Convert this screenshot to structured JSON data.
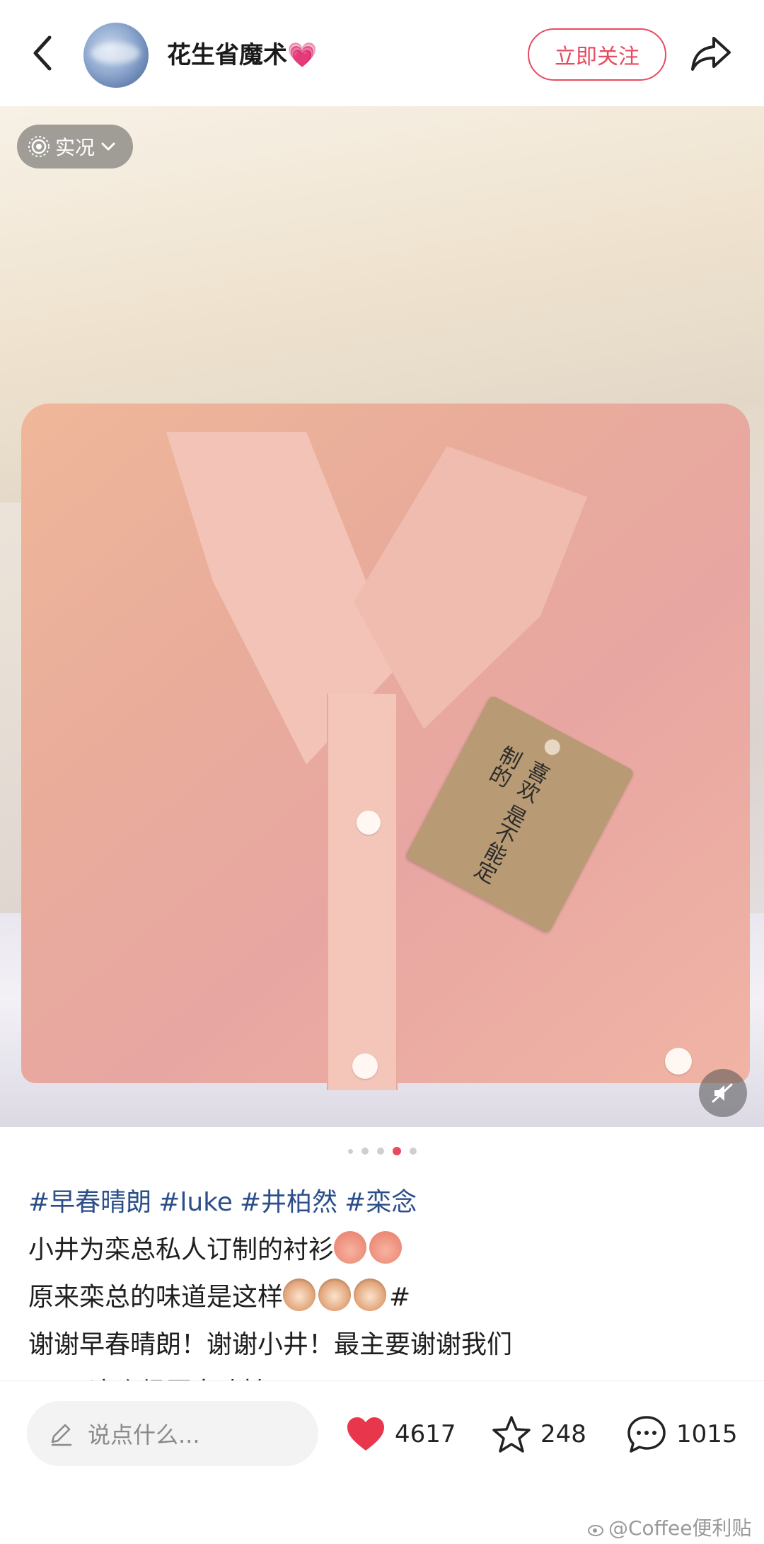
{
  "header": {
    "username": "花生省魔术💗",
    "follow_label": "立即关注"
  },
  "photo": {
    "live_label": "实况",
    "tag_text": "喜欢 是不能定制的"
  },
  "carousel": {
    "count": 5,
    "active_index": 3
  },
  "post": {
    "hashtags": [
      "#早春晴朗",
      "#luke",
      "#井柏然",
      "#栾念"
    ],
    "line1": "小井为栾总私人订制的衬衫",
    "line2": "原来栾总的味道是这样",
    "line2_suffix": "#",
    "line3": "谢谢早春晴朗！谢谢小井！最主要谢谢我们",
    "line4": "luke 这个经历太嗑扯了！！！"
  },
  "bottom_bar": {
    "comment_placeholder": "说点什么...",
    "likes": "4617",
    "favorites": "248",
    "comments": "1015",
    "watermark": "@Coffee便利贴"
  },
  "colors": {
    "accent": "#e84a5f",
    "hashtag": "#2c4f8a",
    "like_heart": "#e8364d"
  },
  "icons": [
    "back-icon",
    "share-icon",
    "live-photo-icon",
    "chevron-down-icon",
    "mute-icon",
    "pencil-icon",
    "heart-icon",
    "star-icon",
    "comment-icon",
    "weibo-icon"
  ]
}
